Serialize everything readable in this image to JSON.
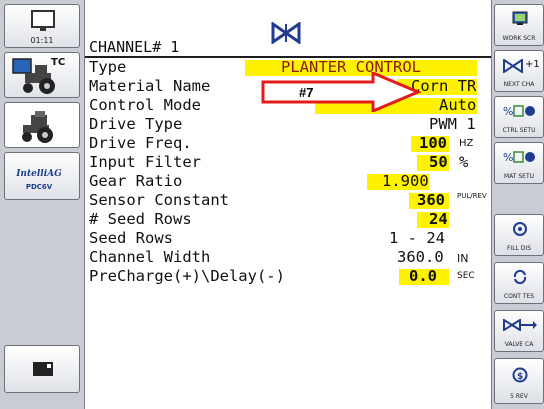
{
  "header": {
    "title": "CHANNEL# 1",
    "icon": "valve-icon"
  },
  "clock": "01:11",
  "left_sidebar": {
    "buttons": [
      {
        "icon": "monitor-icon",
        "text": ""
      },
      {
        "icon": "tractor-tc-icon",
        "text": "TC"
      },
      {
        "icon": "tractor-icon",
        "text": ""
      },
      {
        "icon": "intelliag-logo",
        "brand": "IntelliAG",
        "sub": "PDC6V"
      },
      {
        "icon": "camera-icon",
        "text": ""
      }
    ]
  },
  "right_sidebar": {
    "buttons": [
      {
        "icon": "work-screen-icon",
        "label": "WORK SCR"
      },
      {
        "icon": "next-channel-icon",
        "label": "NEXT CHA",
        "badge": "+1"
      },
      {
        "icon": "ctrl-setup-icon",
        "label": "CTRL SETU"
      },
      {
        "icon": "mat-setup-icon",
        "label": "MAT SETU"
      },
      {
        "icon": "fill-dist-icon",
        "label": "FILL DIS"
      },
      {
        "icon": "cont-test-icon",
        "label": "CONT TES"
      },
      {
        "icon": "valve-cal-icon",
        "label": "VALVE CA"
      },
      {
        "icon": "rev-icon",
        "label": "5 REV"
      }
    ]
  },
  "rows": [
    {
      "label": "Type",
      "value": "PLANTER CONTROL",
      "unit": ""
    },
    {
      "label": "Material Name",
      "value": "Corn TR",
      "unit": ""
    },
    {
      "label": "Control Mode",
      "value": "Auto",
      "unit": ""
    },
    {
      "label": "Drive Type",
      "value": "PWM 1",
      "unit": ""
    },
    {
      "label": "Drive Freq.",
      "value": "100",
      "unit": "HZ"
    },
    {
      "label": "Input Filter",
      "value": "50",
      "unit": "%"
    },
    {
      "label": "Gear Ratio",
      "value": "1.900",
      "unit": ""
    },
    {
      "label": "Sensor Constant",
      "value": "360",
      "unit": "PUL/REV"
    },
    {
      "label": "# Seed Rows",
      "value": "24",
      "unit": ""
    },
    {
      "label": "Seed Rows",
      "value": "1 - 24",
      "unit": ""
    },
    {
      "label": "Channel Width",
      "value": "360.0",
      "unit": "IN"
    },
    {
      "label": "PreCharge(+)\\Delay(-)",
      "value": "0.0",
      "unit": "SEC"
    }
  ],
  "annotation": {
    "label": "#7"
  },
  "colors": {
    "highlight": "#fff200",
    "arrow": "#e21b1b",
    "accent": "#1f3c8f"
  }
}
